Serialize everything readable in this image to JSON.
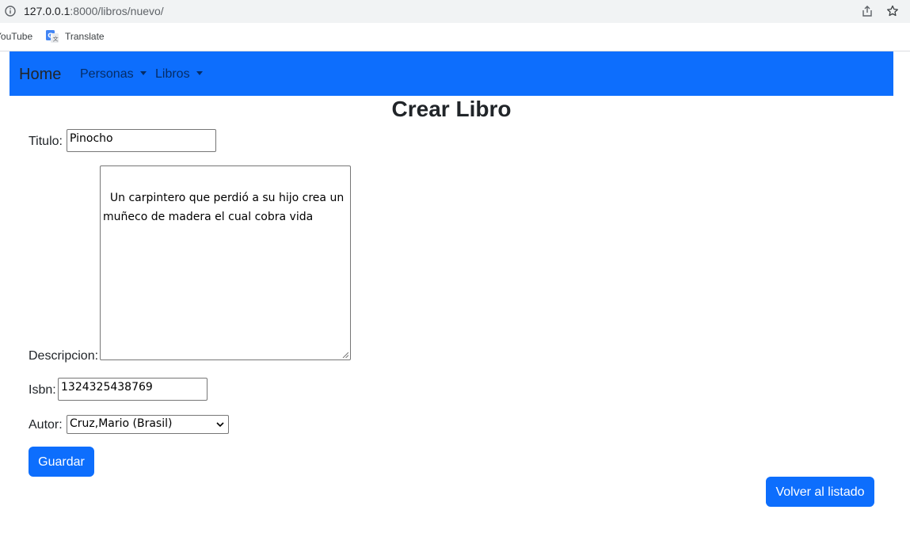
{
  "browser": {
    "url_host": "127.0.0.1",
    "url_rest": ":8000/libros/nuevo/",
    "bookmarks": [
      "YouTube",
      "Translate"
    ]
  },
  "navbar": {
    "brand": "Home",
    "items": [
      {
        "label": "Personas"
      },
      {
        "label": "Libros"
      }
    ],
    "color": "#0d6efd"
  },
  "page": {
    "title": "Crear Libro"
  },
  "form": {
    "titulo_label": "Titulo:",
    "titulo_value": "Pinocho",
    "descripcion_label": "Descripcion:",
    "descripcion_value": "Un carpintero que perdió a su hijo crea un muñeco de madera el cual cobra vida",
    "isbn_label": "Isbn:",
    "isbn_value": "1324325438769",
    "autor_label": "Autor:",
    "autor_selected": "Cruz,Mario (Brasil)",
    "submit_label": "Guardar"
  },
  "actions": {
    "back_label": "Volver al listado"
  }
}
